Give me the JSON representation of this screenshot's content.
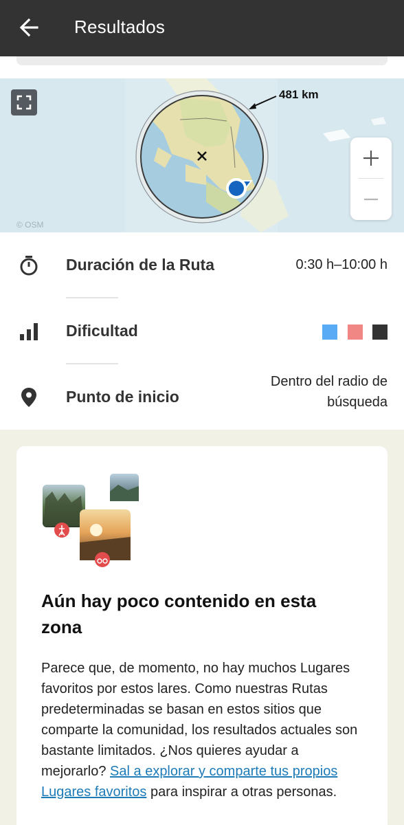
{
  "appbar": {
    "title": "Resultados",
    "back_icon": "arrow-back-icon"
  },
  "map": {
    "radius_label": "481 km",
    "attribution": "© OSM",
    "zoom_in_label": "+",
    "zoom_out_label": "–",
    "icons": [
      "fullscreen-icon",
      "location-marker-icon",
      "center-cross-icon"
    ]
  },
  "filters": {
    "duration": {
      "label": "Duración de la Ruta",
      "value": "0:30 h–10:00 h",
      "icon": "stopwatch-icon"
    },
    "difficulty": {
      "label": "Dificultad",
      "icon": "signal-bars-icon",
      "levels": [
        {
          "name": "easy",
          "color": "#5aabf5"
        },
        {
          "name": "moderate",
          "color": "#f08784"
        },
        {
          "name": "difficult",
          "color": "#333333"
        }
      ]
    },
    "start_point": {
      "label": "Punto de inicio",
      "value_line1": "Dentro del radio de",
      "value_line2": "búsqueda",
      "icon": "pin-icon"
    }
  },
  "notice": {
    "title": "Aún hay poco contenido en esta zona",
    "body_text": "Parece que, de momento, no hay muchos Lugares favoritos por estos lares. Como nuestras Rutas predeterminadas se basan en estos sitios que comparte la comunidad, los resultados actuales son bastante limitados. ¿Nos quieres ayudar a mejorarlo? ",
    "link_text": "Sal a explorar y comparte tus propios Lugares favoritos",
    "body_end": " para inspirar a otras personas.",
    "collage_icons": [
      "hiking-badge-icon",
      "bike-badge-icon"
    ]
  },
  "colors": {
    "appbar": "#333333",
    "background": "#f1f1e6",
    "link": "#1d7bb8",
    "accent_blue": "#1565c0"
  }
}
